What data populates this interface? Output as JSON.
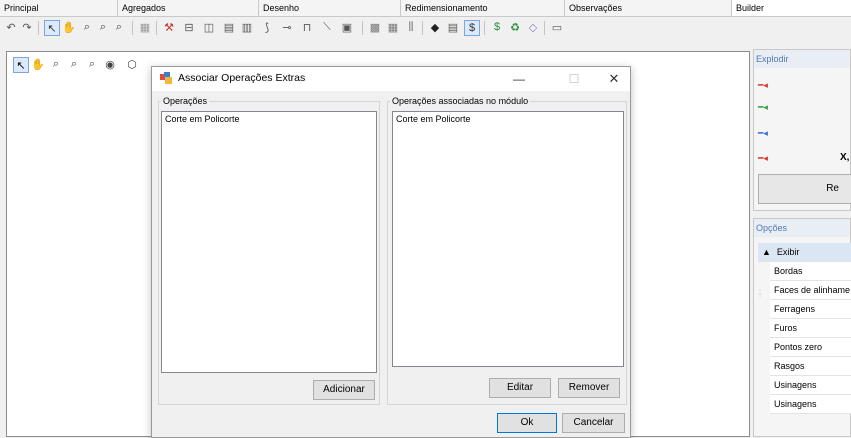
{
  "ribbon": {
    "tabs": [
      "Principal",
      "Agregados",
      "Desenho",
      "Redimensionamento",
      "Observações",
      "Builder"
    ]
  },
  "panels": {
    "explode": {
      "title": "Explodir",
      "label_x": "X,",
      "button_label": "Re",
      "arrow_colors": [
        "#d9342b",
        "#2ea043",
        "#2f6fd6",
        "#d9342b"
      ]
    },
    "options": {
      "title": "Opções",
      "group_label": "Exibir",
      "items": [
        "Bordas",
        "Faces de alinhame",
        "Ferragens",
        "Furos",
        "Pontos zero",
        "Rasgos",
        "Usinagens",
        "Usinagens"
      ]
    }
  },
  "dialog": {
    "title": "Associar Operações Extras",
    "operations": {
      "label": "Operações",
      "items": [
        "Corte em Policorte"
      ],
      "add_button": "Adicionar"
    },
    "associated": {
      "label": "Operações associadas no módulo",
      "items": [
        "Corte em Policorte"
      ],
      "edit_button": "Editar",
      "remove_button": "Remover"
    },
    "ok_button": "Ok",
    "cancel_button": "Cancelar"
  }
}
